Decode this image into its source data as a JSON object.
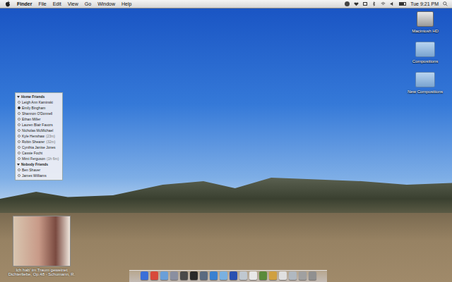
{
  "menu_bar": {
    "app": "Finder",
    "menus": [
      "File",
      "Edit",
      "View",
      "Go",
      "Window",
      "Help"
    ],
    "clock": "Tue 9:21 PM"
  },
  "desktop_icons": [
    {
      "label": "Macintosh HD",
      "kind": "drive"
    },
    {
      "label": "Compositions",
      "kind": "folder"
    },
    {
      "label": "New Compositions",
      "kind": "folder"
    }
  ],
  "buddy_list": {
    "groups": [
      {
        "name": "Home Friends",
        "buddies": [
          {
            "name": "Leigh Ann Kaminski",
            "idle": "",
            "selected": false
          },
          {
            "name": "Emily Bingham",
            "idle": "",
            "selected": true
          },
          {
            "name": "Shannon O'Donnell",
            "idle": "",
            "selected": false
          },
          {
            "name": "Ethan Miller",
            "idle": "",
            "selected": false
          },
          {
            "name": "Lauren Blair Favors",
            "idle": "",
            "selected": false
          },
          {
            "name": "Nicholas McMichael",
            "idle": "",
            "selected": false
          },
          {
            "name": "Kyle Henshaw",
            "idle": "(23m)",
            "selected": false
          },
          {
            "name": "Robin Shearer",
            "idle": "(32m)",
            "selected": false
          },
          {
            "name": "Cynthia Janise Jones",
            "idle": "",
            "selected": false
          },
          {
            "name": "Cassie Focht",
            "idle": "",
            "selected": false
          },
          {
            "name": "Mimi Ferguson",
            "idle": "(1h 6m)",
            "selected": false
          }
        ]
      },
      {
        "name": "Nobody Friends",
        "buddies": [
          {
            "name": "Ben Shaver",
            "idle": "",
            "selected": false
          },
          {
            "name": "James Williams",
            "idle": "",
            "selected": false
          }
        ]
      }
    ]
  },
  "now_playing": {
    "title": "Ich hab' im Traum geweinet",
    "subtitle": "Dichterliebe, Op.48 - Schumann, R."
  }
}
